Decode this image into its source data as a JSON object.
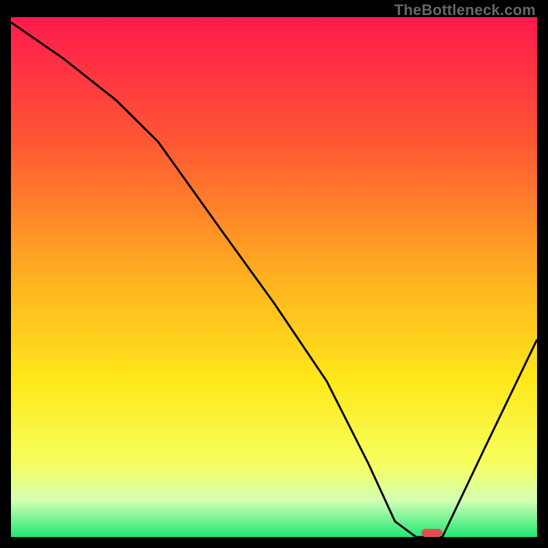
{
  "watermark": "TheBottleneck.com",
  "chart_data": {
    "type": "line",
    "title": "",
    "xlabel": "",
    "ylabel": "",
    "xlim": [
      0,
      100
    ],
    "ylim": [
      0,
      100
    ],
    "curve_note": "values express bottleneck percentage; 0 = green bottom, 100 = red top",
    "x": [
      0,
      10,
      20,
      28,
      40,
      50,
      60,
      68,
      73,
      77,
      80,
      82,
      90,
      100
    ],
    "values": [
      99,
      92,
      84,
      76,
      59,
      45,
      30,
      14,
      3,
      0,
      0,
      0,
      17,
      38
    ],
    "optimum_marker": {
      "x_start": 78,
      "x_end": 82,
      "y": 0
    },
    "gradient_stops": [
      {
        "pos": 0.0,
        "color": "#ff1a4d"
      },
      {
        "pos": 0.25,
        "color": "#ff5a33"
      },
      {
        "pos": 0.5,
        "color": "#ffb020"
      },
      {
        "pos": 0.7,
        "color": "#ffe81a"
      },
      {
        "pos": 0.86,
        "color": "#f6ff60"
      },
      {
        "pos": 0.93,
        "color": "#d3ffb4"
      },
      {
        "pos": 1.0,
        "color": "#1fe874"
      }
    ]
  }
}
